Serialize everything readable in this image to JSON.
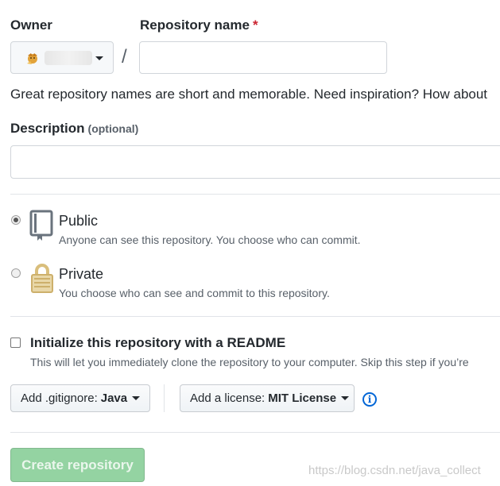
{
  "owner": {
    "label": "Owner"
  },
  "repo_name": {
    "label": "Repository name",
    "required_mark": "*",
    "value": "",
    "placeholder": ""
  },
  "separator": "/",
  "hint": "Great repository names are short and memorable. Need inspiration? How about",
  "description": {
    "label": "Description",
    "optional": "(optional)",
    "value": "",
    "placeholder": ""
  },
  "visibility": {
    "selected": "public",
    "options": [
      {
        "title": "Public",
        "note": "Anyone can see this repository. You choose who can commit.",
        "icon": "book-icon"
      },
      {
        "title": "Private",
        "note": "You choose who can see and commit to this repository.",
        "icon": "lock-icon"
      }
    ]
  },
  "readme": {
    "checked": false,
    "label": "Initialize this repository with a README",
    "note": "This will let you immediately clone the repository to your computer. Skip this step if you’re"
  },
  "gitignore": {
    "prefix": "Add .gitignore:",
    "value": "Java"
  },
  "license": {
    "prefix": "Add a license:",
    "value": "MIT License"
  },
  "info_icon": "i",
  "create_button": "Create repository",
  "watermark": "https://blog.csdn.net/java_collect",
  "colors": {
    "create_button_bg": "#94d3a2",
    "link_blue": "#0366d6",
    "required_red": "#cb2431"
  }
}
